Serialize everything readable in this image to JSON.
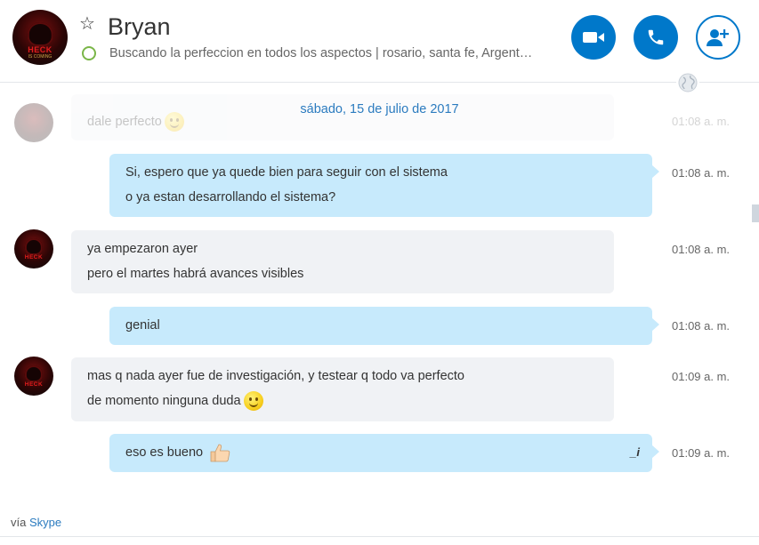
{
  "header": {
    "contact_name": "Bryan",
    "mood_message": "Buscando la perfeccion en todos los aspectos  |  rosario, santa fe, Argent…",
    "avatar_brand": "HECK",
    "avatar_sub": "IS COMING",
    "presence_color": "#7ab648",
    "buttons": {
      "video_icon": "video-camera-icon",
      "call_icon": "phone-icon",
      "add_icon": "add-person-icon"
    }
  },
  "conversation": {
    "date_separator": "sábado, 15 de julio de 2017",
    "messages": [
      {
        "direction": "in",
        "lines": [
          "dale perfecto"
        ],
        "time": "01:08 a. m.",
        "emoji": "smiley",
        "faded": true
      },
      {
        "direction": "out",
        "lines": [
          "Si, espero que ya quede bien para seguir con el sistema",
          "o ya estan desarrollando el sistema?"
        ],
        "time": "01:08 a. m."
      },
      {
        "direction": "in",
        "lines": [
          "ya empezaron ayer",
          "pero el martes habrá avances visibles"
        ],
        "time": "01:08 a. m."
      },
      {
        "direction": "out",
        "lines": [
          "genial"
        ],
        "time": "01:08 a. m."
      },
      {
        "direction": "in",
        "lines": [
          "mas q nada ayer fue de investigación, y testear q todo va perfecto",
          "de momento ninguna duda"
        ],
        "time": "01:09 a. m.",
        "emoji": "smiley"
      },
      {
        "direction": "out",
        "lines": [
          "eso es bueno"
        ],
        "time": "01:09 a. m.",
        "emoji": "thumbs-up",
        "edited_marker": "_i"
      }
    ]
  },
  "footer": {
    "via_label": "vía",
    "link_label": "Skype"
  },
  "colors": {
    "accent": "#0078ca",
    "outgoing_bubble": "#c7eafc",
    "incoming_bubble": "#f0f2f5",
    "link": "#2b7bbf"
  }
}
